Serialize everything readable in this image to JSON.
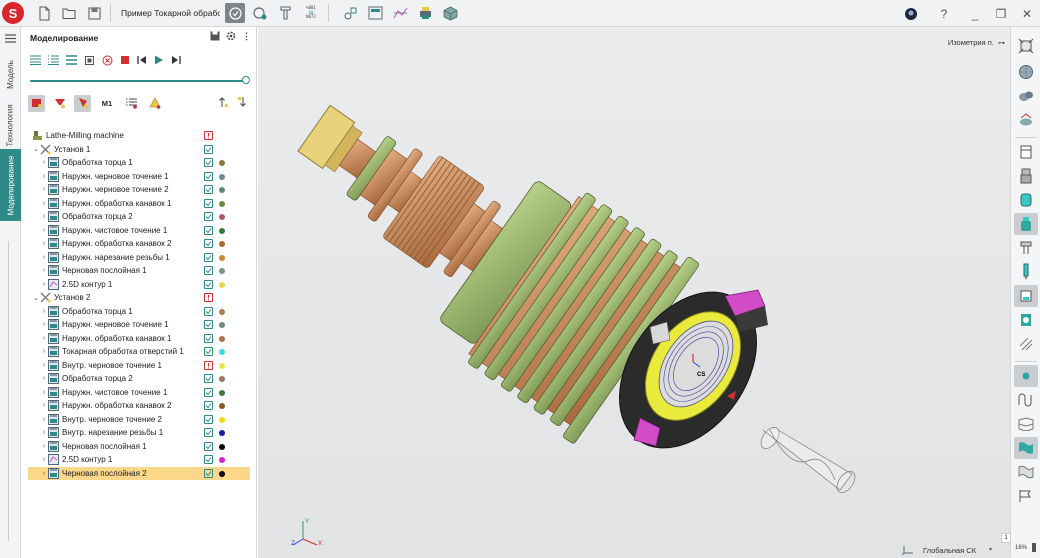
{
  "window": {
    "doc_title": "Пример Токарной обрабо",
    "help_label": "?",
    "minimize_glyph": "_",
    "maximize_glyph": "❐",
    "close_glyph": "✕",
    "logo_text": "S"
  },
  "toolbar": {
    "gcode_top": "%001",
    "gcode_mid": "G0",
    "gcode_bottom": "N072"
  },
  "left_tabs": [
    "Модель",
    "Технология",
    "Моделирование"
  ],
  "panel": {
    "title": "Моделирование",
    "more_glyph": "⋮",
    "m1_label": "M1"
  },
  "tree": [
    {
      "label": "Lathe-Milling machine",
      "check": "error",
      "dot": ""
    },
    {
      "label": "Установ 1",
      "check": "ok",
      "dot": ""
    },
    {
      "label": "Обработка торца 1",
      "check": "ok",
      "dot": "#8a7a3a"
    },
    {
      "label": "Наружн. черновое точение 1",
      "check": "ok",
      "dot": "#6e8a8a"
    },
    {
      "label": "Наружн. черновое точение 2",
      "check": "ok",
      "dot": "#5a8a6a"
    },
    {
      "label": "Наружн. обработка канавок 1",
      "check": "ok",
      "dot": "#6a8a3a"
    },
    {
      "label": "Обработка торца 2",
      "check": "ok",
      "dot": "#a85a6a"
    },
    {
      "label": "Наружн. чистовое точение 1",
      "check": "ok",
      "dot": "#3a7a3a"
    },
    {
      "label": "Наружн. обработка канавок 2",
      "check": "ok",
      "dot": "#a86a2a"
    },
    {
      "label": "Наружн. нарезание резьбы 1",
      "check": "ok",
      "dot": "#c88a2a"
    },
    {
      "label": "Черновая послойная 1",
      "check": "ok",
      "dot": "#7a9a7a"
    },
    {
      "label": "2.5D контур 1",
      "check": "ok",
      "dot": "#e6d84a"
    },
    {
      "label": "Установ 2",
      "check": "error",
      "dot": ""
    },
    {
      "label": "Обработка торца 1",
      "check": "ok",
      "dot": "#a8804a"
    },
    {
      "label": "Наружн. черновое точение 1",
      "check": "ok",
      "dot": "#6e8a8a"
    },
    {
      "label": "Наружн. обработка канавок 1",
      "check": "ok",
      "dot": "#b07048"
    },
    {
      "label": "Токарная обработка отверстий 1",
      "check": "ok",
      "dot": "#3ad8e8"
    },
    {
      "label": "Внутр. черновое точение 1",
      "check": "error",
      "dot": "#e8e84a"
    },
    {
      "label": "Обработка торца 2",
      "check": "ok",
      "dot": "#a87060"
    },
    {
      "label": "Наружн. чистовое точение 1",
      "check": "ok",
      "dot": "#3a7a3a"
    },
    {
      "label": "Наружн. обработка канавок 2",
      "check": "ok",
      "dot": "#8a5a2a"
    },
    {
      "label": "Внутр. черновое точение 2",
      "check": "ok",
      "dot": "#f0e000"
    },
    {
      "label": "Внутр. нарезание резьбы 1",
      "check": "ok",
      "dot": "#1a1aa8"
    },
    {
      "label": "Черновая послойная 1",
      "check": "ok",
      "dot": "#000000"
    },
    {
      "label": "2.5D контур 1",
      "check": "ok",
      "dot": "#d020d0"
    },
    {
      "label": "Черновая послойная 2",
      "check": "ok",
      "dot": "#000000",
      "selected": true
    }
  ],
  "viewport": {
    "view_mode": "Изометрия п.",
    "csys_label": "Глобальная СК",
    "zoom": "16%",
    "axis_x": "X",
    "axis_y": "Y",
    "axis_z": "Z",
    "tool_marker": "CS"
  },
  "right_bar": {
    "badge": "1"
  },
  "colors": {
    "accent": "#2f8a87",
    "selected_row": "#fbd78a",
    "part_green": "#98b86a",
    "part_copper": "#c8895a",
    "chuck_magenta": "#d24cc8",
    "part_yellow": "#eaea3c"
  }
}
